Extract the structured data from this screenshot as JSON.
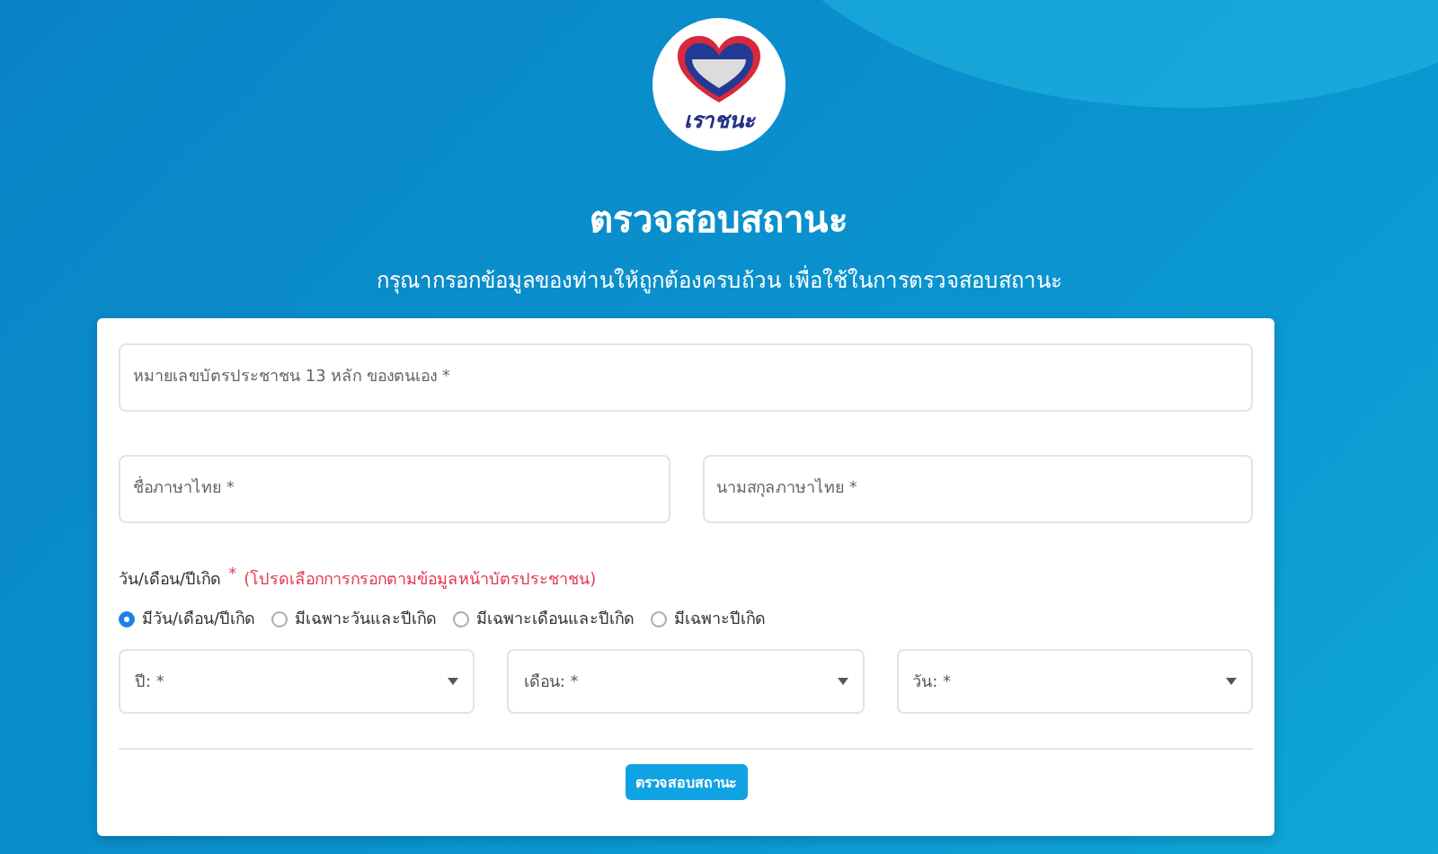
{
  "logo": {
    "text": "เราชนะ"
  },
  "title": "ตรวจสอบสถานะ",
  "subtitle": "กรุณากรอกข้อมูลของท่านให้ถูกต้องครบถ้วน เพื่อใช้ในการตรวจสอบสถานะ",
  "id_field": {
    "placeholder": "หมายเลขบัตรประชาชน 13 หลัก ของตนเอง *"
  },
  "name_fields": [
    {
      "placeholder": "ชื่อภาษาไทย *"
    },
    {
      "placeholder": "นามสกุลภาษาไทย *"
    }
  ],
  "birthdate": {
    "label": "วัน/เดือน/ปีเกิด",
    "required_mark": "*",
    "hint": "(โปรดเลือกการกรอกตามข้อมูลหน้าบัตรประชาชน)",
    "options": [
      {
        "label": "มีวัน/เดือน/ปีเกิด",
        "selected": true
      },
      {
        "label": "มีเฉพาะวันและปีเกิด",
        "selected": false
      },
      {
        "label": "มีเฉพาะเดือนและปีเกิด",
        "selected": false
      },
      {
        "label": "มีเฉพาะปีเกิด",
        "selected": false
      }
    ],
    "selects": [
      {
        "placeholder": "ปี: *"
      },
      {
        "placeholder": "เดือน: *"
      },
      {
        "placeholder": "วัน: *"
      }
    ]
  },
  "submit_button": "ตรวจสอบสถานะ"
}
